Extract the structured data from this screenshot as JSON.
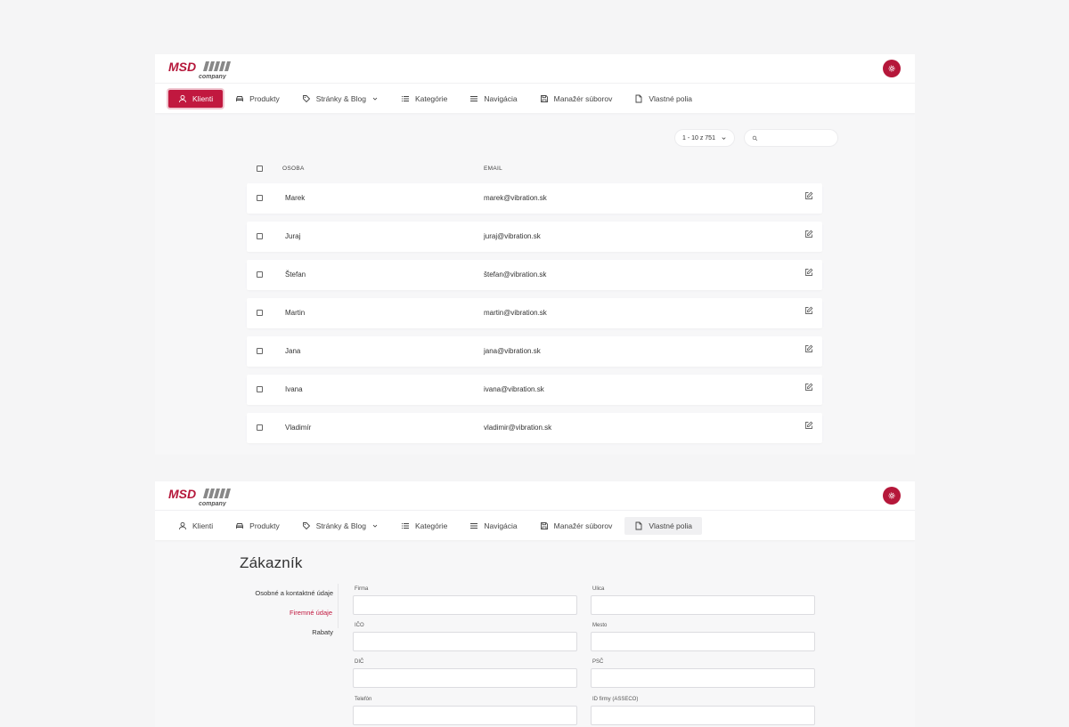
{
  "brand": {
    "logo_text": "MSD",
    "logo_sub": "company",
    "accent": "#b5173a"
  },
  "nav": [
    {
      "label": "Klienti",
      "icon": "user-icon"
    },
    {
      "label": "Produkty",
      "icon": "car-icon"
    },
    {
      "label": "Stránky & Blog",
      "icon": "tag-icon",
      "has_dropdown": true
    },
    {
      "label": "Kategórie",
      "icon": "list-icon"
    },
    {
      "label": "Navigácia",
      "icon": "menu-icon"
    },
    {
      "label": "Manažér súborov",
      "icon": "save-icon"
    },
    {
      "label": "Vlastné polia",
      "icon": "file-icon"
    }
  ],
  "clients": {
    "pagination": "1 - 10 z 751",
    "search_placeholder": "",
    "columns": [
      "OSOBA",
      "EMAIL"
    ],
    "rows": [
      {
        "name": "Marek",
        "email": "marek@vibration.sk"
      },
      {
        "name": "Juraj",
        "email": "juraj@vibration.sk"
      },
      {
        "name": "Štefan",
        "email": "štefan@vibration.sk"
      },
      {
        "name": "Martin",
        "email": "martin@vibration.sk"
      },
      {
        "name": "Jana",
        "email": "jana@vibration.sk"
      },
      {
        "name": "Ivana",
        "email": "ivana@vibration.sk"
      },
      {
        "name": "Vladimír",
        "email": "vladimir@vibration.sk"
      }
    ]
  },
  "customer": {
    "title": "Zákazník",
    "tabs": [
      {
        "label": "Osobné a kontaktné údaje"
      },
      {
        "label": "Firemné údaje"
      },
      {
        "label": "Rabaty"
      }
    ],
    "fields": [
      {
        "label": "Firma",
        "value": ""
      },
      {
        "label": "Ulica",
        "value": ""
      },
      {
        "label": "IČO",
        "value": ""
      },
      {
        "label": "Mesto",
        "value": ""
      },
      {
        "label": "DIČ",
        "value": ""
      },
      {
        "label": "PSČ",
        "value": ""
      },
      {
        "label": "Telefón",
        "value": ""
      },
      {
        "label": "ID firmy (ASSECO)",
        "value": ""
      }
    ]
  }
}
